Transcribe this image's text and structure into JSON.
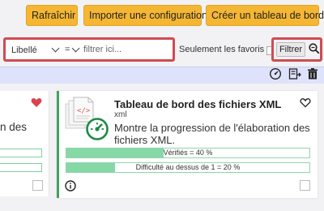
{
  "toolbar": {
    "refresh_label": "Rafraîchir",
    "import_label": "Importer une configuration",
    "create_label": "Créer un tableau de bord"
  },
  "filter": {
    "field_label": "Libellé",
    "operator": "=",
    "input_placeholder": "filtrer ici...",
    "favorites_label": "Seulement les favoris",
    "favorites_checked": false,
    "filter_button_label": "Filtrer"
  },
  "actions": {
    "icons": [
      "gauge-icon",
      "list-export-icon",
      "trash-icon"
    ]
  },
  "left_card": {
    "text_line1": "n des",
    "favorite": true,
    "favorite_color": "#d9434e"
  },
  "card": {
    "title": "Tableau de bord des fichiers XML",
    "subtitle": "xml",
    "description": "Montre la progression de l'élaboration des fichiers XML.",
    "favorite": false,
    "accent_color": "#3fa45f",
    "progress": [
      {
        "label": "Vérifiés = 40 %",
        "fraction": 0.4
      },
      {
        "label": "Difficulté au dessus de 1 = 20 %",
        "fraction": 0.2
      }
    ]
  },
  "colors": {
    "button_orange": "#f5b733",
    "highlight_red": "#d04b52",
    "band_blue": "#dfe2fb",
    "progress_green": "#86d9a7"
  }
}
